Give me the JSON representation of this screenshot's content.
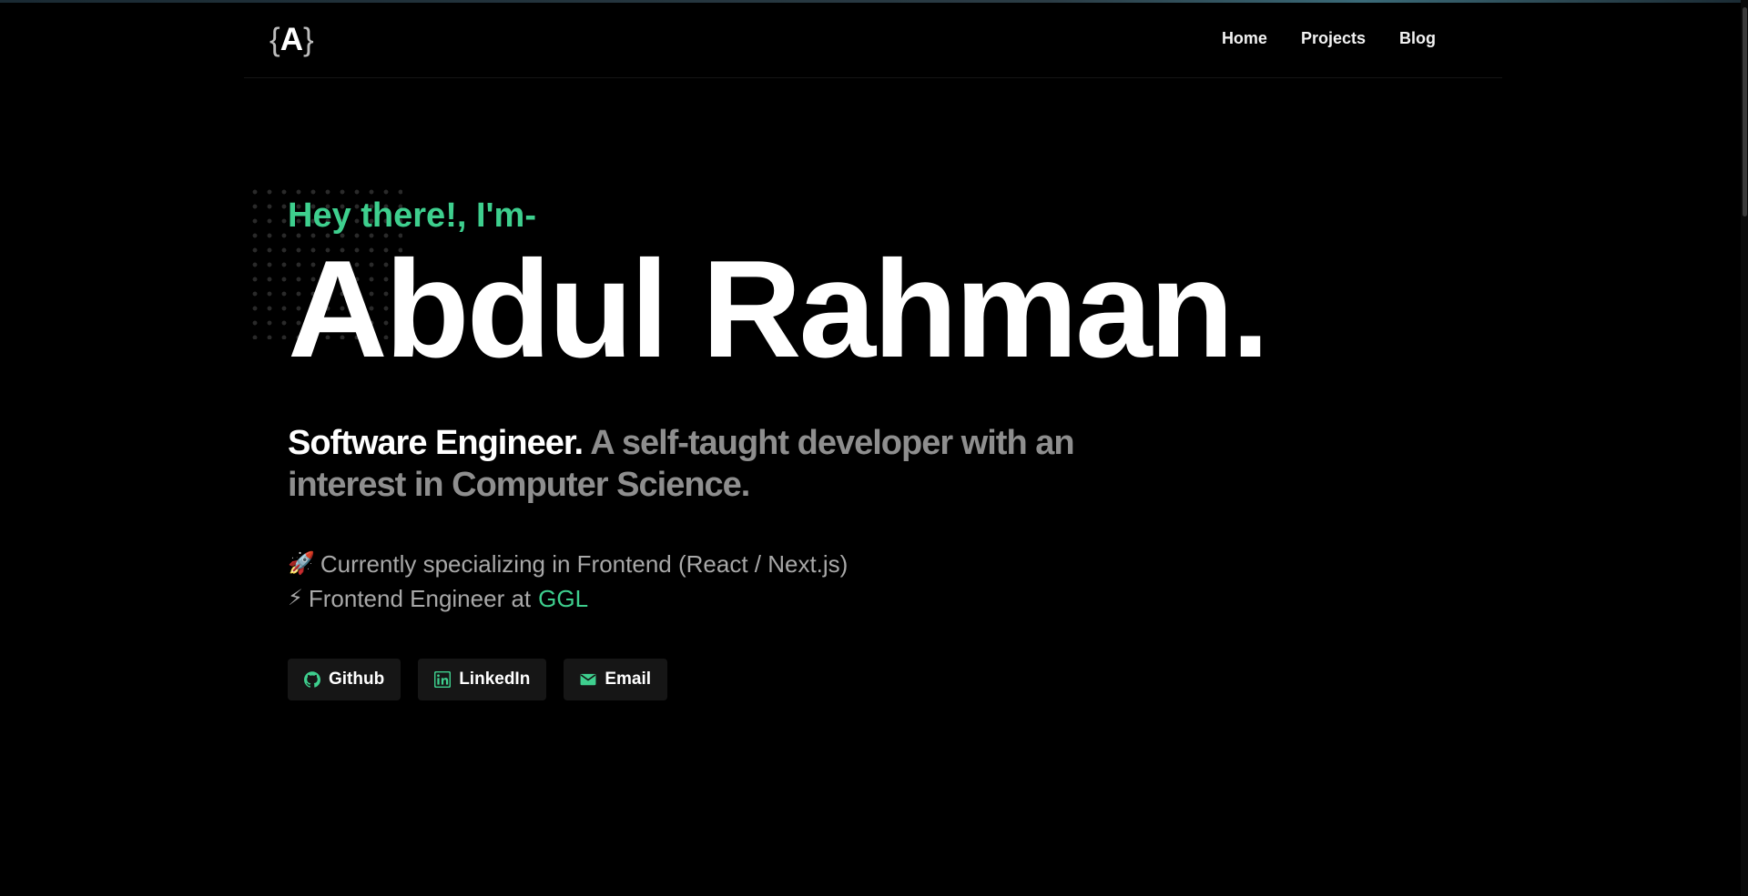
{
  "header": {
    "logo": {
      "open": "{",
      "letter": "A",
      "close": "}"
    },
    "nav": [
      {
        "label": "Home"
      },
      {
        "label": "Projects"
      },
      {
        "label": "Blog"
      }
    ]
  },
  "hero": {
    "greeting": "Hey there!, I'm-",
    "name": "Abdul Rahman.",
    "tagline_role": "Software Engineer.",
    "tagline_rest": " A self-taught developer with an interest in Computer Science."
  },
  "facts": [
    {
      "emoji": "🚀",
      "text": "Currently specializing in Frontend (React / Next.js)"
    },
    {
      "emoji": "⚡",
      "text": "Frontend Engineer at",
      "link": "GGL"
    }
  ],
  "buttons": [
    {
      "label": "Github",
      "icon": "github-icon"
    },
    {
      "label": "LinkedIn",
      "icon": "linkedin-icon"
    },
    {
      "label": "Email",
      "icon": "mail-icon"
    }
  ],
  "colors": {
    "accent": "#3ecf8e",
    "background": "#000000",
    "muted_text": "#8e8e8e"
  }
}
